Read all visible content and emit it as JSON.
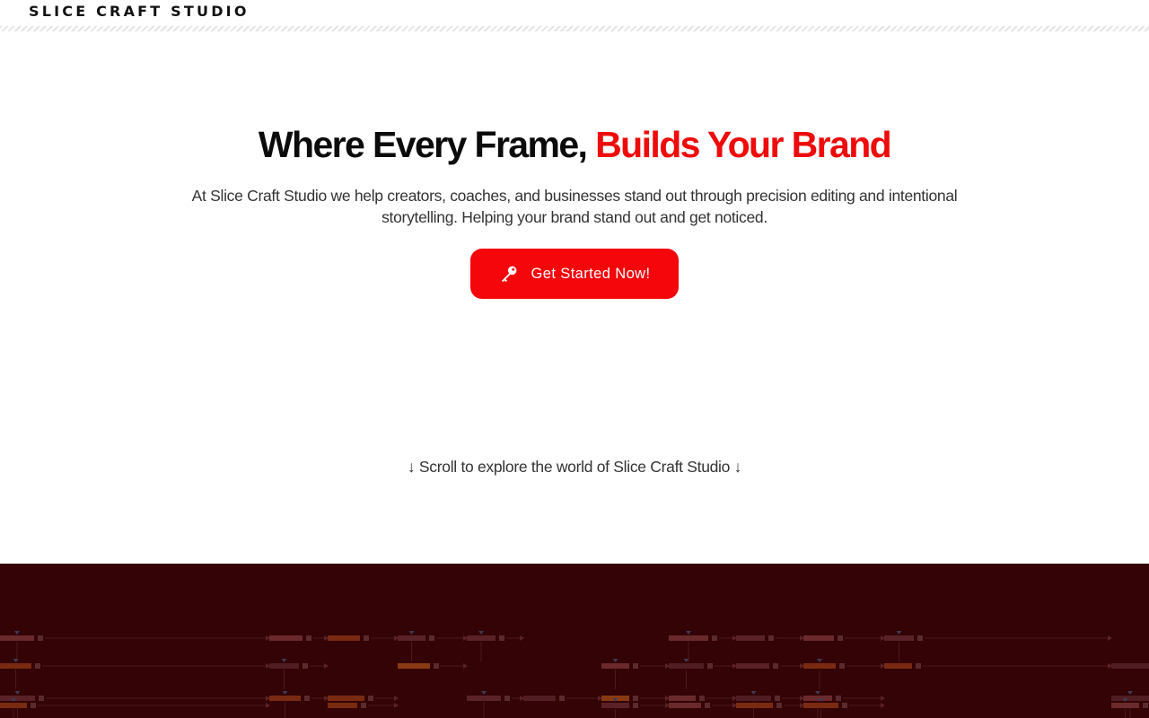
{
  "header": {
    "brand": "SLICE CRAFT STUDIO"
  },
  "hero": {
    "headline_main": "Where Every Frame, ",
    "headline_accent": "Builds Your Brand",
    "subtext": "At Slice Craft Studio we help creators, coaches, and businesses stand out through precision editing and intentional storytelling. Helping your brand stand out and get noticed.",
    "cta_label": "Get Started Now!",
    "cta_icon": "key-icon",
    "scroll_hint": "↓ Scroll to explore the world of Slice Craft Studio ↓"
  },
  "colors": {
    "accent": "#ee0b0b",
    "button": "#f4060b",
    "dark_band": "#330305",
    "text": "#0b0b0b"
  }
}
